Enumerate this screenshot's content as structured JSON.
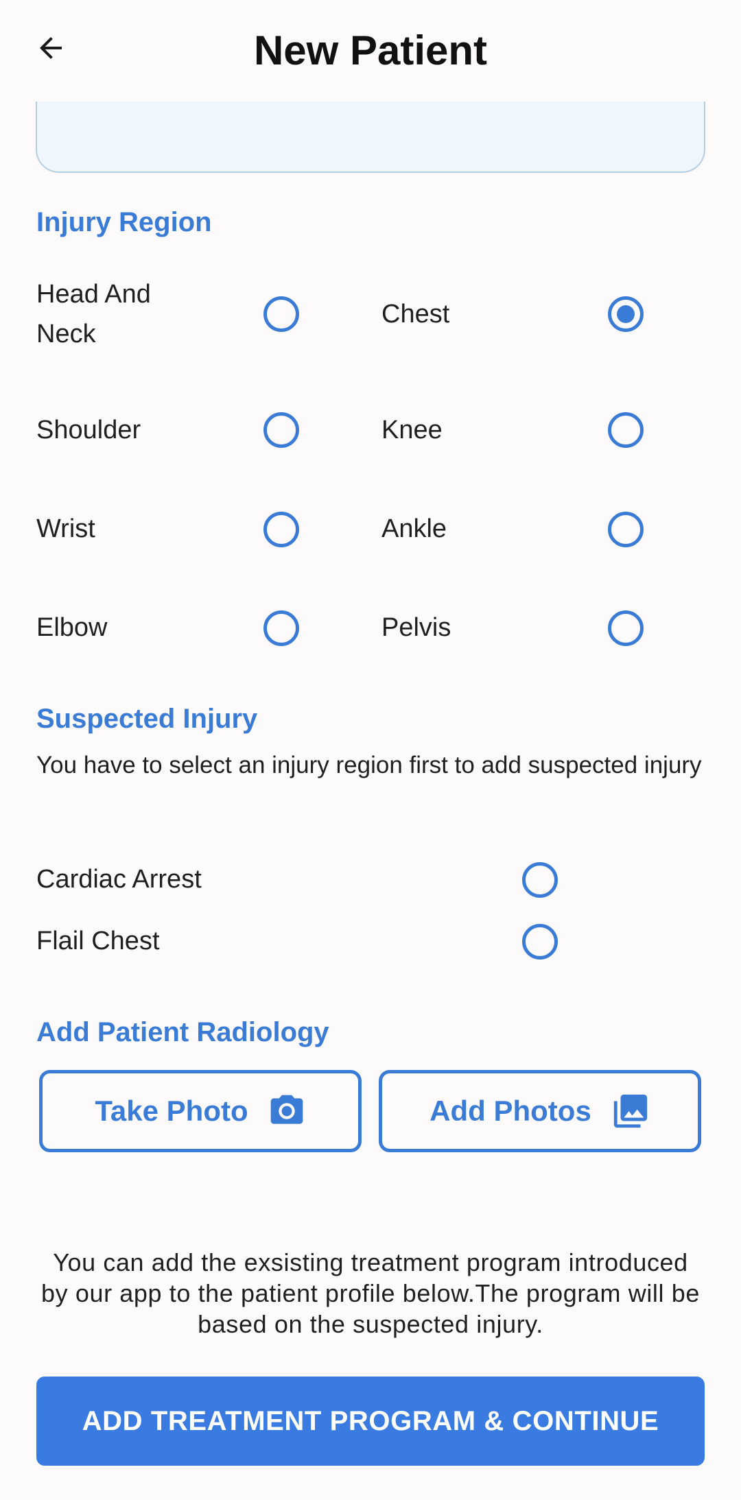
{
  "header": {
    "title": "New Patient"
  },
  "injury_region": {
    "title": "Injury Region",
    "options": [
      {
        "label": "Head And Neck",
        "checked": false
      },
      {
        "label": "Chest",
        "checked": true
      },
      {
        "label": "Shoulder",
        "checked": false
      },
      {
        "label": "Knee",
        "checked": false
      },
      {
        "label": "Wrist",
        "checked": false
      },
      {
        "label": "Ankle",
        "checked": false
      },
      {
        "label": "Elbow",
        "checked": false
      },
      {
        "label": "Pelvis",
        "checked": false
      }
    ]
  },
  "suspected_injury": {
    "title": "Suspected Injury",
    "hint": "You have to select an injury region first to add suspected injury",
    "options": [
      {
        "label": "Cardiac Arrest",
        "checked": false
      },
      {
        "label": "Flail Chest",
        "checked": false
      }
    ]
  },
  "radiology": {
    "title": "Add Patient Radiology",
    "take_photo_label": "Take Photo",
    "add_photos_label": "Add Photos",
    "take_photo_icon": "camera-icon",
    "add_photos_icon": "photo-library-icon"
  },
  "treatment": {
    "info": "You can add the exsisting treatment program introduced by our app to the patient profile below.The program will be based on the suspected injury.",
    "button_label": "ADD TREATMENT PROGRAM & CONTINUE"
  },
  "colors": {
    "accent": "#3a7bd5",
    "button": "#3a7be2",
    "background": "#fdfafc",
    "field_fill": "#eff6fd"
  }
}
